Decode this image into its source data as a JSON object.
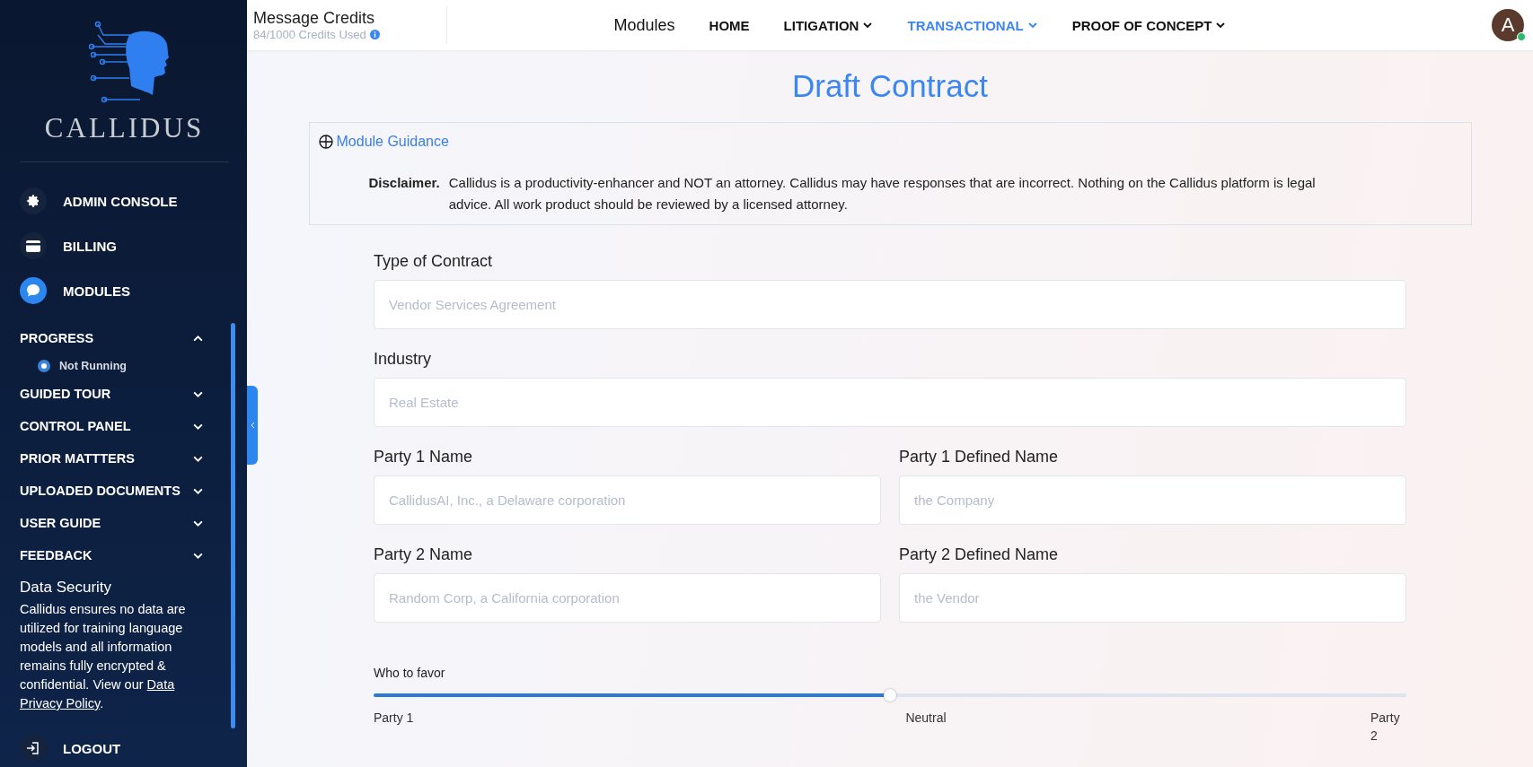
{
  "sidebar": {
    "logo_text": "CALLIDUS",
    "menu": [
      {
        "label": "ADMIN CONSOLE",
        "kind": "gear",
        "selected": false
      },
      {
        "label": "BILLING",
        "kind": "card",
        "selected": false
      },
      {
        "label": "MODULES",
        "kind": "chat",
        "selected": true
      }
    ],
    "sections": [
      {
        "label": "PROGRESS",
        "expanded": true,
        "children": [
          {
            "label": "Not Running"
          }
        ]
      },
      {
        "label": "GUIDED TOUR",
        "expanded": false
      },
      {
        "label": "CONTROL PANEL",
        "expanded": false
      },
      {
        "label": "PRIOR MATTTERS",
        "expanded": false
      },
      {
        "label": "UPLOADED DOCUMENTS",
        "expanded": false
      },
      {
        "label": "USER GUIDE",
        "expanded": false
      },
      {
        "label": "FEEDBACK",
        "expanded": false
      }
    ],
    "data_security": {
      "title": "Data Security",
      "text": "Callidus ensures no data are utilized for training language models and all information remains fully encrypted & confidential. View our",
      "link": "Data Privacy Policy",
      "end": "."
    },
    "logout": "LOGOUT"
  },
  "credits": {
    "title": "Message Credits",
    "used": "84/1000 Credits Used"
  },
  "nav": [
    {
      "label": "Modules",
      "kind": "brand",
      "selected": false,
      "dropdown": false
    },
    {
      "label": "HOME",
      "kind": "link",
      "selected": false,
      "dropdown": false
    },
    {
      "label": "LITIGATION",
      "kind": "link",
      "selected": false,
      "dropdown": true
    },
    {
      "label": "TRANSACTIONAL",
      "kind": "link",
      "selected": true,
      "dropdown": true
    },
    {
      "label": "PROOF OF CONCEPT",
      "kind": "link",
      "selected": false,
      "dropdown": true
    }
  ],
  "avatar": {
    "initial": "A",
    "online": true
  },
  "page_title": "Draft Contract",
  "guidance": {
    "toggle": "Module Guidance",
    "expanded": false,
    "disclaimer_label": "Disclaimer.",
    "disclaimer": "Callidus is a productivity-enhancer and NOT an attorney. Callidus may have responses that are incorrect. Nothing on the Callidus platform is legal advice. All work product should be reviewed by a licensed attorney."
  },
  "form_rows": [
    [
      {
        "label": "Type of Contract",
        "placeholder": "Vendor Services Agreement"
      }
    ],
    [
      {
        "label": "Industry",
        "placeholder": "Real Estate"
      }
    ],
    [
      {
        "label": "Party 1 Name",
        "placeholder": "CallidusAI, Inc., a Delaware corporation"
      },
      {
        "label": "Party 1 Defined Name",
        "placeholder": "the Company"
      }
    ],
    [
      {
        "label": "Party 2 Name",
        "placeholder": "Random Corp, a California corporation"
      },
      {
        "label": "Party 2 Defined Name",
        "placeholder": "the Vendor"
      }
    ]
  ],
  "slider": {
    "label": "Who to favor",
    "level": 0.5,
    "ticks": [
      "Party 1",
      "Neutral",
      "Party 2"
    ]
  }
}
